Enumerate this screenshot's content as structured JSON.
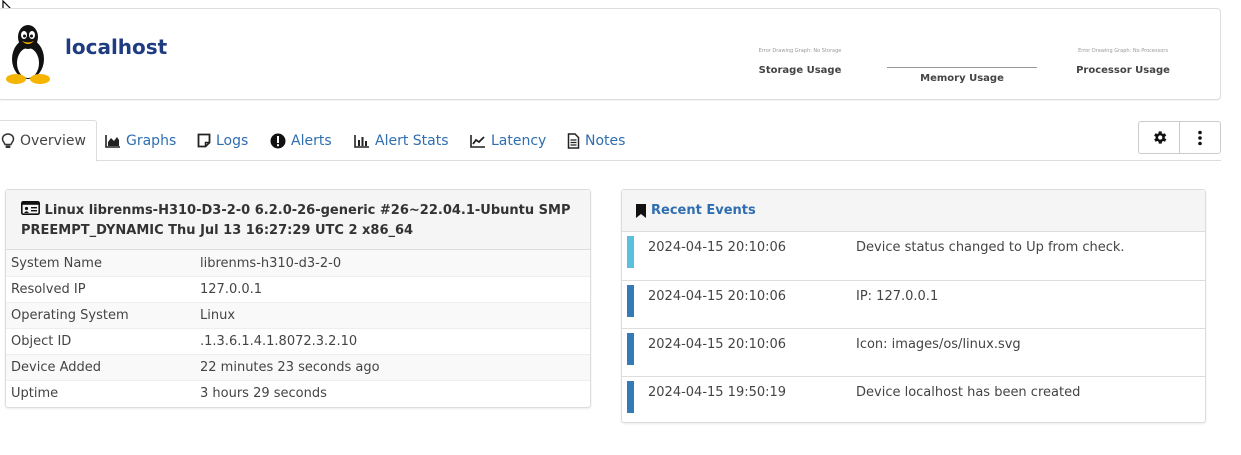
{
  "device": {
    "hostname": "localhost",
    "os_icon": "tux-penguin-icon"
  },
  "mini_graphs": [
    {
      "error": "Error Drawing Graph: No Storage",
      "label": "Storage Usage"
    },
    {
      "error": "",
      "label": "Memory Usage"
    },
    {
      "error": "Error Drawing Graph: No Processors",
      "label": "Processor Usage"
    }
  ],
  "tabs": [
    {
      "label": "Overview",
      "icon": "lightbulb-icon",
      "active": true
    },
    {
      "label": "Graphs",
      "icon": "area-chart-icon"
    },
    {
      "label": "Logs",
      "icon": "sticky-note-icon"
    },
    {
      "label": "Alerts",
      "icon": "exclamation-circle-icon"
    },
    {
      "label": "Alert Stats",
      "icon": "bar-chart-icon"
    },
    {
      "label": "Latency",
      "icon": "line-chart-icon"
    },
    {
      "label": "Notes",
      "icon": "file-text-icon"
    }
  ],
  "toolbar": {
    "settings_icon": "gear-icon",
    "more_icon": "vertical-ellipsis-icon"
  },
  "overview": {
    "title": "Linux librenms-H310-D3-2-0 6.2.0-26-generic #26~22.04.1-Ubuntu SMP PREEMPT_DYNAMIC Thu Jul 13 16:27:29 UTC 2 x86_64",
    "rows": [
      {
        "key": "System Name",
        "value": "librenms-h310-d3-2-0"
      },
      {
        "key": "Resolved IP",
        "value": "127.0.0.1"
      },
      {
        "key": "Operating System",
        "value": "Linux"
      },
      {
        "key": "Object ID",
        "value": ".1.3.6.1.4.1.8072.3.2.10"
      },
      {
        "key": "Device Added",
        "value": "22 minutes 23 seconds ago"
      },
      {
        "key": "Uptime",
        "value": "3 hours 29 seconds"
      }
    ]
  },
  "events": {
    "title": "Recent Events",
    "items": [
      {
        "timestamp": "2024-04-15 20:10:06",
        "message": "Device status changed to Up from check.",
        "color": "#5bc0de"
      },
      {
        "timestamp": "2024-04-15 20:10:06",
        "message": "IP: 127.0.0.1",
        "color": "#337ab7"
      },
      {
        "timestamp": "2024-04-15 20:10:06",
        "message": "Icon: images/os/linux.svg",
        "color": "#337ab7"
      },
      {
        "timestamp": "2024-04-15 19:50:19",
        "message": "Device localhost has been created",
        "color": "#337ab7"
      }
    ]
  }
}
